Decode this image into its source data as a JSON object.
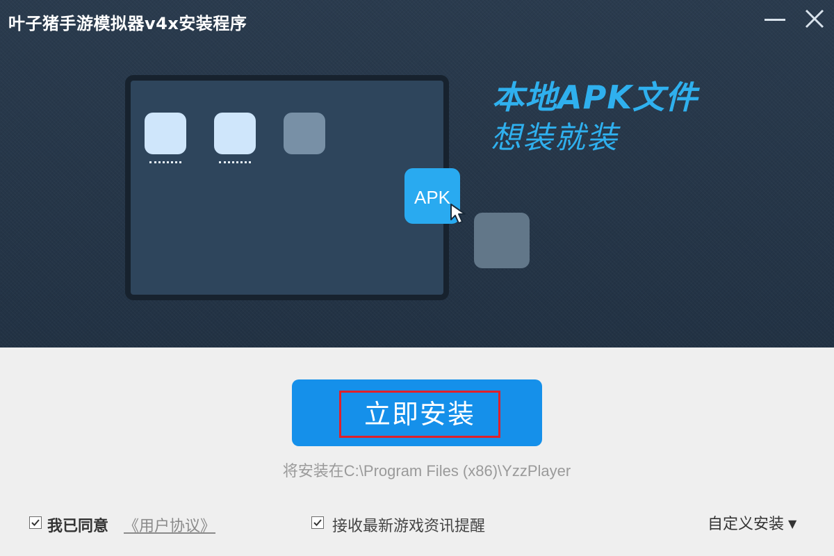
{
  "window": {
    "title": "叶子猪手游模拟器v4x安装程序"
  },
  "banner": {
    "slogan_line1": "本地APK文件",
    "slogan_line2": "想装就装",
    "apk_label": "APK"
  },
  "install": {
    "button_label": "立即安装",
    "path_text": "将安装在C:\\Program Files (x86)\\YzzPlayer"
  },
  "footer": {
    "agree_label": "我已同意",
    "agree_checked": true,
    "agreement_link": "《用户协议》",
    "news_label": "接收最新游戏资讯提醒",
    "news_checked": true,
    "custom_install_label": "自定义安装"
  },
  "colors": {
    "banner_bg": "#263648",
    "accent_blue": "#1590ea",
    "slogan_blue": "#2fb0ee",
    "highlight_red": "#e0202a",
    "panel_bg": "#efefef"
  },
  "icons": [
    "minimize-icon",
    "close-icon",
    "cursor-icon",
    "checkbox-check-icon",
    "dropdown-triangle-icon"
  ]
}
